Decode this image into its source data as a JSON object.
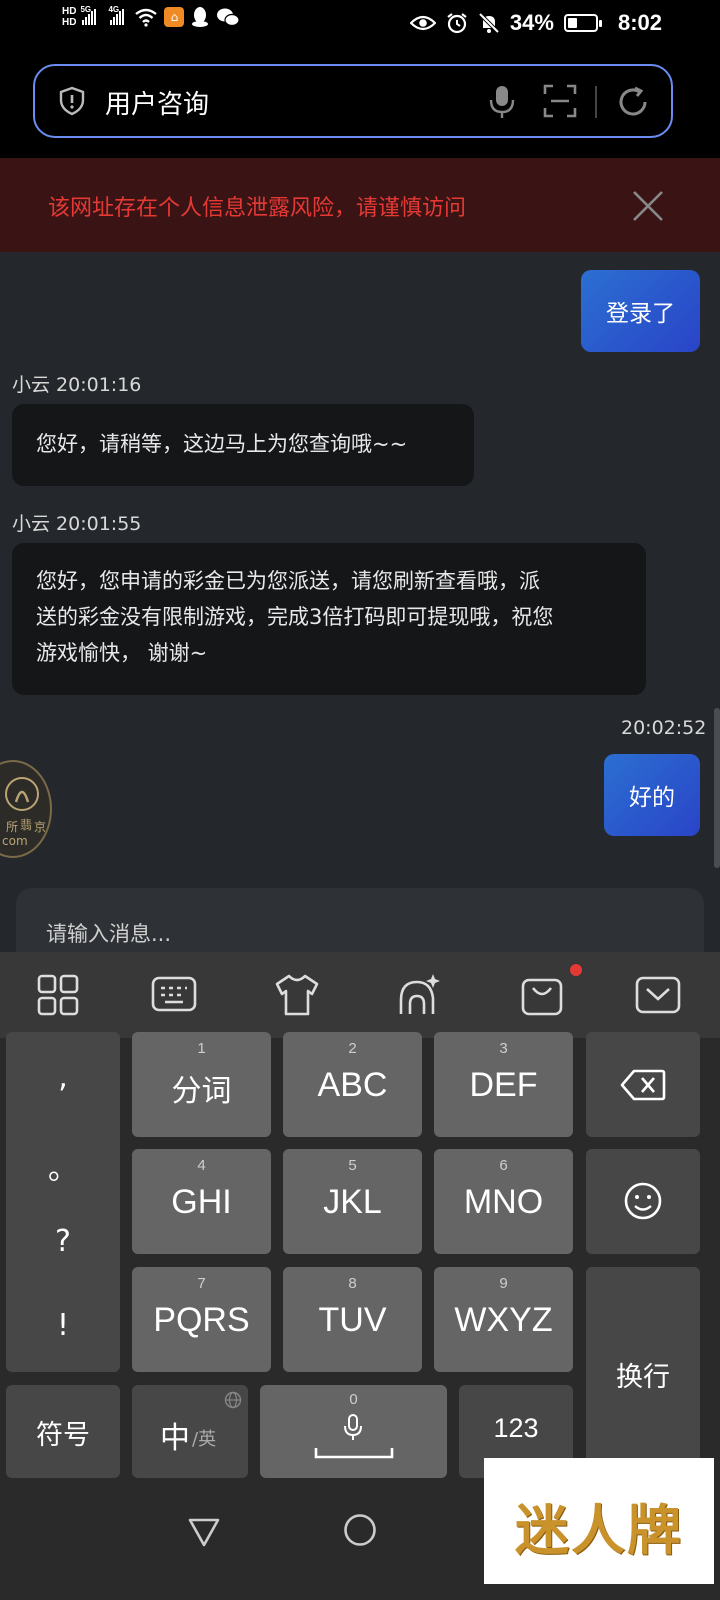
{
  "status_bar": {
    "hd1": "HD",
    "hd2": "HD",
    "net1": "5G",
    "net2": "4G",
    "battery_pct": "34%",
    "battery_level": 0.34,
    "time": "8:02"
  },
  "url_bar": {
    "text": "用户咨询"
  },
  "warning": {
    "text": "该网址存在个人信息泄露风险，请谨慎访问",
    "color": "#e53935"
  },
  "chat": {
    "messages": [
      {
        "side": "out",
        "text": "登录了"
      },
      {
        "side": "in",
        "sender_time": "小云 20:01:16",
        "text": "您好，请稍等，这边马上为您查询哦~~"
      },
      {
        "side": "in",
        "sender_time": "小云 20:01:55",
        "lines": [
          "您好，您申请的彩金已为您派送，请您刷新查看哦，派",
          "送的彩金没有限制游戏，完成3倍打码即可提现哦，祝您",
          "游戏愉快， 谢谢~"
        ]
      },
      {
        "side": "out",
        "time": "20:02:52",
        "text": "好的"
      }
    ],
    "avatar_text": [
      "所",
      "翡",
      "京",
      "com"
    ]
  },
  "input": {
    "placeholder": "请输入消息..."
  },
  "keyboard": {
    "punct": [
      ",",
      "。",
      "?",
      "!"
    ],
    "keys": [
      {
        "num": "1",
        "label": "分词"
      },
      {
        "num": "2",
        "label": "ABC"
      },
      {
        "num": "3",
        "label": "DEF"
      },
      {
        "num": "4",
        "label": "GHI"
      },
      {
        "num": "5",
        "label": "JKL"
      },
      {
        "num": "6",
        "label": "MNO"
      },
      {
        "num": "7",
        "label": "PQRS"
      },
      {
        "num": "8",
        "label": "TUV"
      },
      {
        "num": "9",
        "label": "WXYZ"
      }
    ],
    "symbol_label": "符号",
    "lang_main": "中",
    "lang_alt": "/英",
    "space_num": "0",
    "num_key_label": "123",
    "enter_label": "换行"
  },
  "watermark": {
    "text": "迷人牌"
  },
  "colors": {
    "accent": "#2b6fd1",
    "url_border": "#6b8cf0",
    "warning_bg": "#3a1414",
    "chat_bg": "#24282c"
  }
}
